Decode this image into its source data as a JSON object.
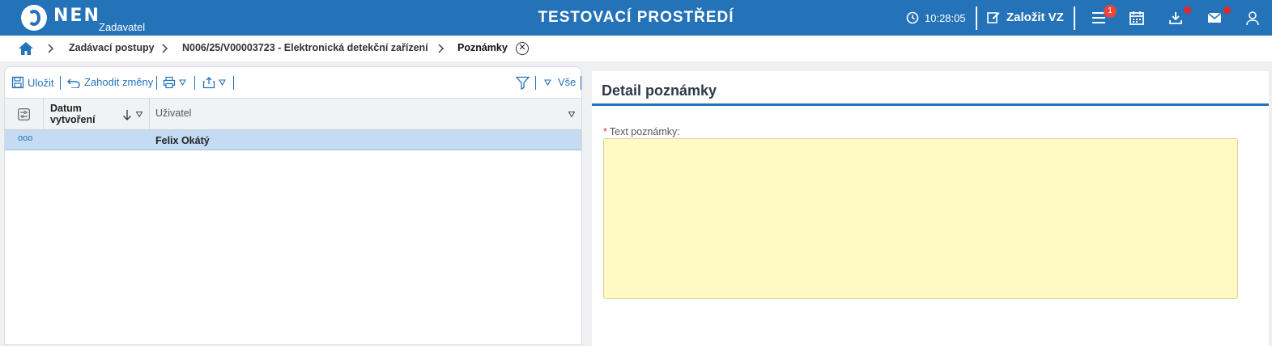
{
  "header": {
    "brand": "NEN",
    "role": "Zadavatel",
    "environment": "TESTOVACÍ PROSTŘEDÍ",
    "time": "10:28:05",
    "create_label": "Založit VZ",
    "menu_badge": "1",
    "colors": {
      "bar": "#2472b8",
      "badge": "#e8453c"
    }
  },
  "breadcrumb": {
    "items": [
      "Zadávací postupy",
      "N006/25/V00003723 - Elektronická detekční zařízení"
    ],
    "current": "Poznámky"
  },
  "toolbar": {
    "save": "Uložit",
    "discard": "Zahodit změny",
    "filter_label": "Vše"
  },
  "grid": {
    "columns": {
      "date": "Datum vytvoření",
      "user": "Uživatel"
    },
    "rows": [
      {
        "more": "ooo",
        "date": "",
        "user": "Felix Okátý"
      }
    ]
  },
  "detail": {
    "title": "Detail poznámky",
    "field_label": "Text poznámky:",
    "required_mark": "*",
    "value": ""
  }
}
